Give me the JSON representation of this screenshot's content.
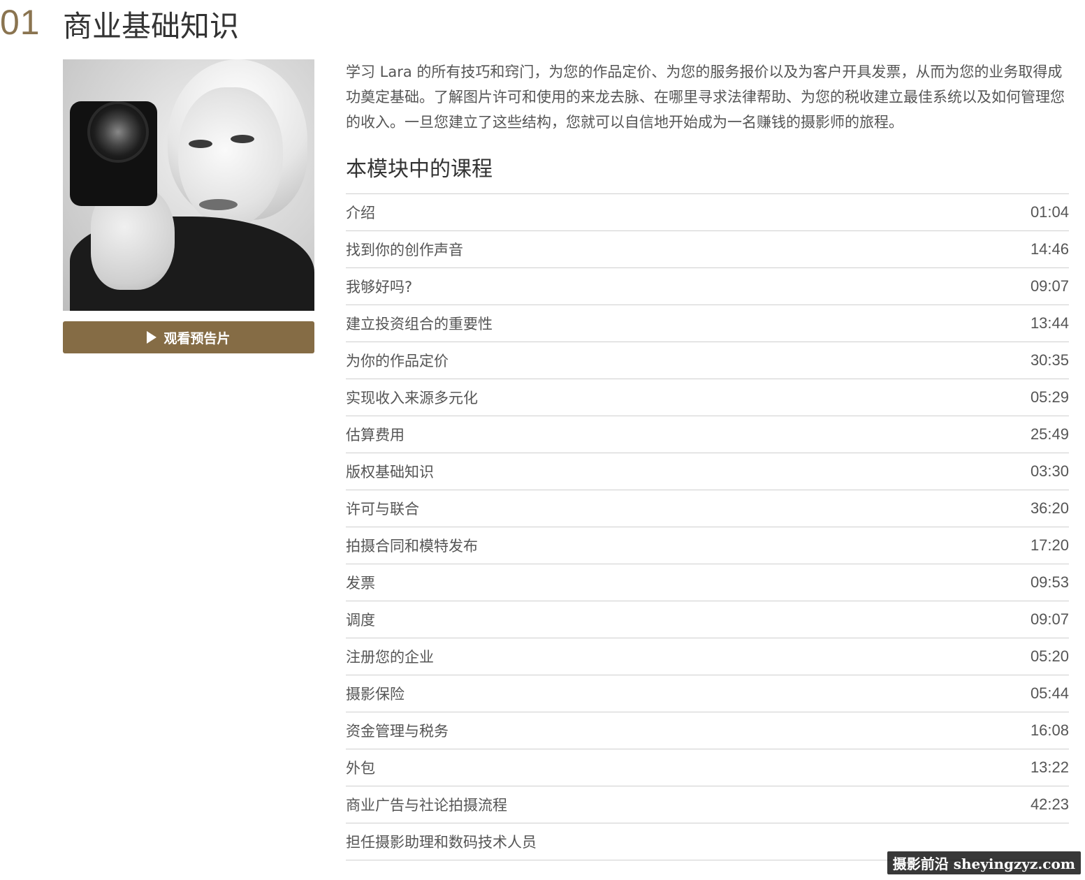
{
  "module": {
    "number": "01",
    "title": "商业基础知识",
    "trailer_label": "观看预告片",
    "description": "学习 Lara 的所有技巧和窍门，为您的作品定价、为您的服务报价以及为客户开具发票，从而为您的业务取得成功奠定基础。了解图片许可和使用的来龙去脉、在哪里寻求法律帮助、为您的税收建立最佳系统以及如何管理您的收入。一旦您建立了这些结构，您就可以自信地开始成为一名赚钱的摄影师的旅程。",
    "lessons_heading": "本模块中的课程"
  },
  "lessons": [
    {
      "title": "介绍",
      "duration": "01:04"
    },
    {
      "title": "找到你的创作声音",
      "duration": "14:46"
    },
    {
      "title": "我够好吗?",
      "duration": "09:07"
    },
    {
      "title": "建立投资组合的重要性",
      "duration": "13:44"
    },
    {
      "title": "为你的作品定价",
      "duration": "30:35"
    },
    {
      "title": "实现收入来源多元化",
      "duration": "05:29"
    },
    {
      "title": "估算费用",
      "duration": "25:49"
    },
    {
      "title": "版权基础知识",
      "duration": "03:30"
    },
    {
      "title": "许可与联合",
      "duration": "36:20"
    },
    {
      "title": "拍摄合同和模特发布",
      "duration": "17:20"
    },
    {
      "title": "发票",
      "duration": "09:53"
    },
    {
      "title": "调度",
      "duration": "09:07"
    },
    {
      "title": "注册您的企业",
      "duration": "05:20"
    },
    {
      "title": "摄影保险",
      "duration": "05:44"
    },
    {
      "title": "资金管理与税务",
      "duration": "16:08"
    },
    {
      "title": "外包",
      "duration": "13:22"
    },
    {
      "title": "商业广告与社论拍摄流程",
      "duration": "42:23"
    },
    {
      "title": "担任摄影助理和数码技术人员",
      "duration": ""
    }
  ],
  "watermark": "摄影前沿 sheyingzyz.com",
  "colors": {
    "accent": "#8a7450",
    "button": "#856c45"
  },
  "icons": {
    "trailer": "play-icon"
  }
}
